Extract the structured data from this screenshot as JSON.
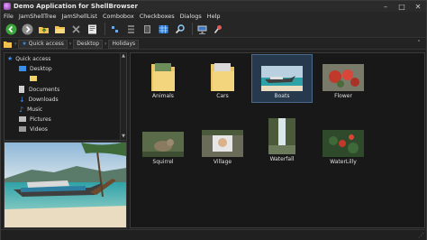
{
  "window": {
    "title": "Demo Application for ShellBrowser",
    "minimize": "–",
    "maximize": "□",
    "close": "✕"
  },
  "menu": [
    "File",
    "JamShellTree",
    "JamShellList",
    "Combobox",
    "Checkboxes",
    "Dialogs",
    "Help"
  ],
  "toolbar": {
    "buttons": [
      "back-icon",
      "forward-icon",
      "folder-up-icon",
      "folder-open-icon",
      "delete-icon",
      "properties-icon",
      "view-small-icon",
      "view-list-icon",
      "view-details-icon",
      "view-thumbnails-icon",
      "search-icon",
      "network-drive-icon",
      "map-icon"
    ]
  },
  "address": {
    "crumbs": [
      "Quick access",
      "Desktop",
      "Holidays"
    ],
    "dropdown": "˅"
  },
  "tree": {
    "items": [
      {
        "label": "Quick access",
        "icon": "star-icon",
        "level": 0,
        "color": "#3b8ee8"
      },
      {
        "label": "Desktop",
        "icon": "desktop-icon",
        "level": 1,
        "color": "#3b8ee8"
      },
      {
        "label": "",
        "icon": "folder-icon",
        "level": 2,
        "color": "#f2d36b"
      },
      {
        "label": "Documents",
        "icon": "documents-icon",
        "level": 1,
        "color": "#bdbdbd"
      },
      {
        "label": "Downloads",
        "icon": "downloads-icon",
        "level": 1,
        "color": "#3b8ee8"
      },
      {
        "label": "Music",
        "icon": "music-icon",
        "level": 1,
        "color": "#3b8ee8"
      },
      {
        "label": "Pictures",
        "icon": "pictures-icon",
        "level": 1,
        "color": "#bdbdbd"
      },
      {
        "label": "Videos",
        "icon": "videos-icon",
        "level": 1,
        "color": "#bdbdbd"
      }
    ]
  },
  "files": [
    {
      "name": "Animals",
      "kind": "folder",
      "selected": false
    },
    {
      "name": "Cars",
      "kind": "folder",
      "selected": false
    },
    {
      "name": "Boats",
      "kind": "photo",
      "selected": true
    },
    {
      "name": "Flower",
      "kind": "photo",
      "selected": false
    },
    {
      "name": "Squirrel",
      "kind": "photo",
      "selected": false
    },
    {
      "name": "Village",
      "kind": "photo",
      "selected": false
    },
    {
      "name": "Waterfall",
      "kind": "photo",
      "selected": false
    },
    {
      "name": "WaterLilly",
      "kind": "photo",
      "selected": false
    }
  ],
  "colors": {
    "accent": "#3b8ee8",
    "selection": "#26394d",
    "background": "#181818"
  }
}
